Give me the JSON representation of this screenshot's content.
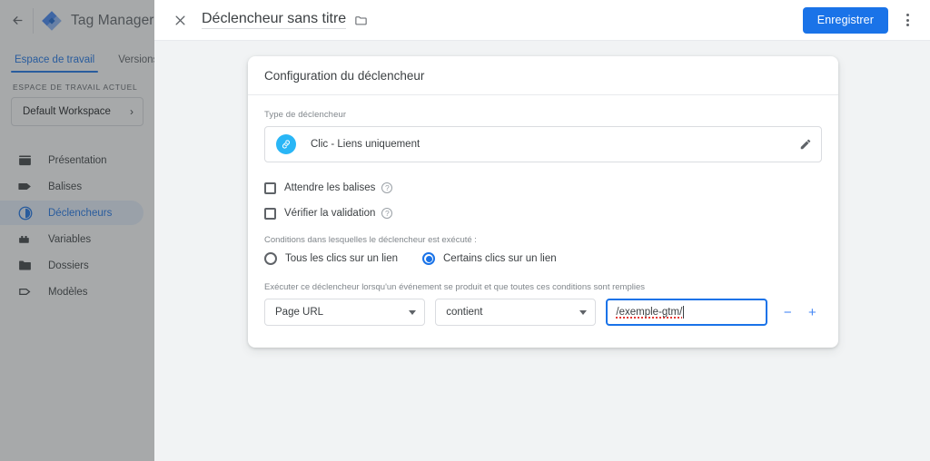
{
  "brand": {
    "back_icon": "back-arrow-icon",
    "logo_icon": "tag-manager-logo-icon",
    "name": "Tag Manager"
  },
  "tabs": [
    {
      "label": "Espace de travail",
      "active": true
    },
    {
      "label": "Versions",
      "active": false
    }
  ],
  "workspace": {
    "section_label": "ESPACE DE TRAVAIL ACTUEL",
    "name": "Default Workspace",
    "chevron": "›"
  },
  "sidebar": {
    "items": [
      {
        "label": "Présentation",
        "icon": "overview-icon",
        "active": false
      },
      {
        "label": "Balises",
        "icon": "tag-icon",
        "active": false
      },
      {
        "label": "Déclencheurs",
        "icon": "trigger-icon",
        "active": true
      },
      {
        "label": "Variables",
        "icon": "variables-icon",
        "active": false
      },
      {
        "label": "Dossiers",
        "icon": "folder-icon",
        "active": false
      },
      {
        "label": "Modèles",
        "icon": "template-icon",
        "active": false
      }
    ]
  },
  "header": {
    "close_icon": "close-icon",
    "title": "Déclencheur sans titre",
    "folder_icon": "folder-move-icon",
    "save_label": "Enregistrer",
    "menu_icon": "more-options-icon"
  },
  "card": {
    "title": "Configuration du déclencheur",
    "type_label": "Type de déclencheur",
    "type_value": "Clic - Liens uniquement",
    "type_icon": "link-click-icon",
    "edit_icon": "pencil-icon",
    "checkboxes": [
      {
        "label": "Attendre les balises",
        "checked": false,
        "help": "?"
      },
      {
        "label": "Vérifier la validation",
        "checked": false,
        "help": "?"
      }
    ],
    "conditions_note": "Conditions dans lesquelles le déclencheur est exécuté :",
    "radios": [
      {
        "label": "Tous les clics sur un lien",
        "selected": false
      },
      {
        "label": "Certains clics sur un lien",
        "selected": true
      }
    ],
    "exec_note": "Exécuter ce déclencheur lorsqu'un événement se produit et que toutes ces conditions sont remplies",
    "condition_row": {
      "variable": "Page URL",
      "operator": "contient",
      "value": "/exemple-gtm/",
      "remove_label": "−",
      "add_label": "+"
    }
  },
  "colors": {
    "accent": "#1a73e8",
    "page_bg": "#f1f3f4",
    "type_avatar": "#29b6f6",
    "spellcheck": "#e53935"
  }
}
